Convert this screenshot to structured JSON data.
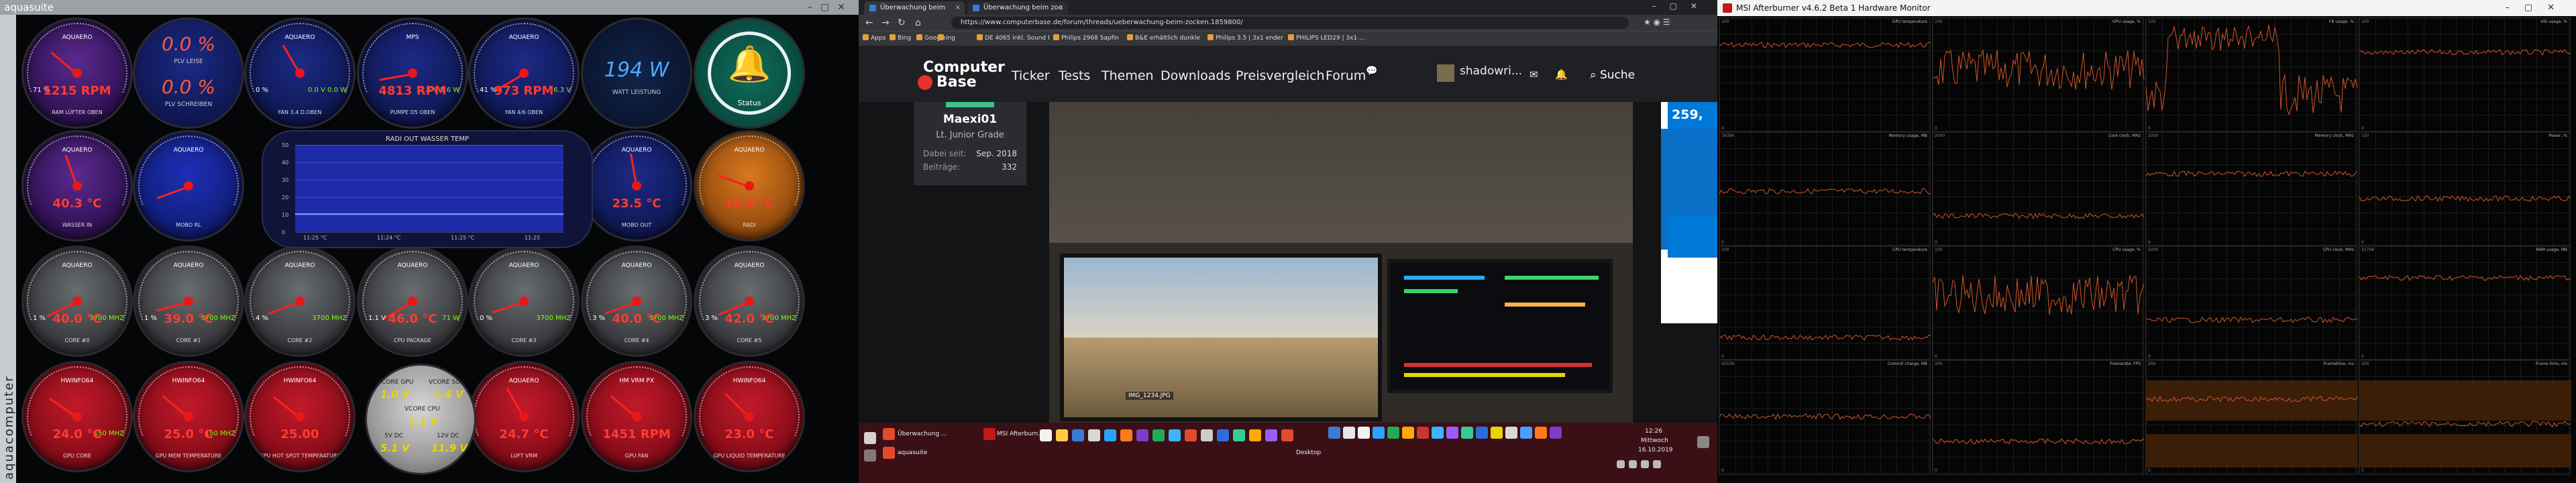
{
  "aquasuite": {
    "title": "aquasuite",
    "brand": "aquacomputer",
    "gauges": [
      {
        "label": "AQUAERO",
        "value": "1215 RPM",
        "unit": "",
        "name": "RAM LÜFTER OBEN",
        "left": "71 %",
        "right": ""
      },
      {
        "label": "",
        "value": "0.0 %",
        "unit": "",
        "name": "PLV LEISE",
        "left": "",
        "right": ""
      },
      {
        "label": "AQUAERO",
        "value": "",
        "unit": "",
        "name": "FAN 3.4 D.OBEN",
        "left": "0 %",
        "right": "0.0 V 0.0 W"
      },
      {
        "label": "MPS",
        "value": "4813 RPM",
        "unit": "",
        "name": "PUMPE D5 OBEN",
        "left": "",
        "right": "12.1 V 5.6 W"
      },
      {
        "label": "AQUAERO",
        "value": "973 RPM",
        "unit": "",
        "name": "FAN 4/6 OBEN",
        "left": "41 %",
        "right": "6.3 V"
      },
      {
        "label": "AQUAERO",
        "value": "40.3 °C",
        "unit": "°C",
        "name": "WASSER IN",
        "left": "",
        "right": ""
      },
      {
        "label": "AQUAERO",
        "value": "",
        "unit": "°C",
        "name": "MOBO RL",
        "left": "",
        "right": ""
      },
      {
        "label": "AQUAERO",
        "value": "23.5 °C",
        "unit": "°C",
        "name": "MOBO OUT",
        "left": "",
        "right": ""
      },
      {
        "label": "AQUAERO",
        "value": "19.8 °C",
        "unit": "°C",
        "name": "RADI",
        "left": "",
        "right": ""
      },
      {
        "label": "AQUAERO",
        "value": "40.0 °C",
        "unit": "°C",
        "name": "CORE #0",
        "left": "1 %",
        "right": "3700 MHZ"
      },
      {
        "label": "AQUAERO",
        "value": "39.0 °C",
        "unit": "°C",
        "name": "CORE #1",
        "left": "1 %",
        "right": "3700 MHZ"
      },
      {
        "label": "AQUAERO",
        "value": "",
        "unit": "°C",
        "name": "CORE #2",
        "left": "4 %",
        "right": "3700 MHZ"
      },
      {
        "label": "AQUAERO",
        "value": "46.0 °C",
        "unit": "°C",
        "name": "CPU PACKAGE",
        "left": "1.1 V",
        "right": "71 W"
      },
      {
        "label": "AQUAERO",
        "value": "",
        "unit": "°C",
        "name": "CORE #3",
        "left": "0 %",
        "right": "3700 MHZ"
      },
      {
        "label": "AQUAERO",
        "value": "40.0 °C",
        "unit": "°C",
        "name": "CORE #4",
        "left": "3 %",
        "right": "3700 MHZ"
      },
      {
        "label": "AQUAERO",
        "value": "42.0 °C",
        "unit": "°C",
        "name": "CORE #5",
        "left": "3 %",
        "right": "3700 MHZ"
      },
      {
        "label": "HWINFO64",
        "value": "24.0 °C",
        "unit": "°C",
        "name": "GPU CORE",
        "left": "",
        "right": "150 MHZ"
      },
      {
        "label": "HWINFO64",
        "value": "25.0 °C",
        "unit": "°C",
        "name": "GPU MEM TEMPERATURE",
        "left": "",
        "right": "150 MHZ"
      },
      {
        "label": "HWINFO64",
        "value": "25.00",
        "unit": "",
        "name": "GPU HOT SPOT TEMPERATURE",
        "left": "",
        "right": ""
      },
      {
        "label": "AQUAERO",
        "value": "24.7 °C",
        "unit": "°C",
        "name": "LUFT VRM",
        "left": "",
        "right": ""
      },
      {
        "label": "HM VRM PX",
        "value": "1451 RPM",
        "unit": "",
        "name": "GPU FAN",
        "left": "",
        "right": ""
      },
      {
        "label": "HWINFO64",
        "value": "23.0 °C",
        "unit": "°C",
        "name": "GPU LIQUID TEMPERATURE",
        "left": "",
        "right": ""
      }
    ],
    "digital": {
      "value": "194 W",
      "name": "WATT LEISTUNG"
    },
    "extra": {
      "top": "0.0 %",
      "top_label": "PLV LEISE",
      "bottom": "0.0 %",
      "bottom_label": "PLV SCHREIBEN"
    },
    "status": {
      "label": "Status"
    },
    "chart": {
      "title": "RADI OUT WASSER TEMP",
      "y_ticks": [
        "50",
        "40",
        "30",
        "20",
        "10",
        "0"
      ],
      "x_ticks": [
        "11:25 °C",
        "11:24 °C",
        "11:25 °C",
        "11:25"
      ]
    },
    "center": {
      "gpu_label": "VCORE GPU",
      "gpu_val": "1.0 V",
      "soc_label": "VCORE SOC",
      "soc_val": "1.4 V",
      "cpu_label": "VCORE CPU",
      "cpu_val": "1.1 V",
      "v5_label": "5V DC",
      "v5_val": "5.1 V",
      "v12_label": "12V DC",
      "v12_val": "11.9 V"
    }
  },
  "browser": {
    "tabs": [
      "Überwachung beim zocken",
      "Überwachung beim zoc"
    ],
    "url": "https://www.computerbase.de/forum/threads/ueberwachung-beim-zocken.1859800/",
    "bookmarks": [
      "Apps",
      "Bing",
      "Google",
      "ing",
      "DE 4065 inkl. Sound I",
      "Philips 2968 Sapfin",
      "B&E erhältlich dunkle",
      "Philips 3.5 | 3x1 ender",
      "PHILIPS LED29 | 3x1 ..."
    ],
    "logo_line1": "Computer",
    "logo_line2": "Base",
    "nav": [
      "Ticker",
      "Tests",
      "Themen",
      "Downloads",
      "Preisvergleich",
      "Forum"
    ],
    "username": "shadowri...",
    "search": "Suche",
    "post": {
      "name": "Maexi01",
      "rank": "Lt. Junior Grade",
      "joined_label": "Dabei seit:",
      "joined": "Sep. 2018",
      "posts_label": "Beiträge:",
      "posts": "332"
    },
    "photo_tag": "IMG_1234.JPG",
    "ad_price": "259,",
    "taskbar": {
      "items": [
        "Überwachung ...",
        "MSI Afterburn...",
        "aquasuite",
        "Desktop"
      ],
      "time": "12:26",
      "day": "Mittwoch",
      "date": "16.10.2019"
    }
  },
  "afterburner": {
    "title": "MSI Afterburner v4.6.2 Beta 1 Hardware Monitor",
    "graphs": [
      {
        "label": "GPU temperature",
        "top": "100",
        "bottom": "0"
      },
      {
        "label": "GPU usage, %",
        "top": "100",
        "bottom": "0"
      },
      {
        "label": "FB usage, %",
        "top": "100",
        "bottom": "0"
      },
      {
        "label": "VID usage, %",
        "top": "100",
        "bottom": "0"
      },
      {
        "label": "Memory usage, MB",
        "top": "16384",
        "bottom": "0"
      },
      {
        "label": "Core clock, MHz",
        "top": "2000",
        "bottom": "0"
      },
      {
        "label": "Memory clock, MHz",
        "top": "2000",
        "bottom": "0"
      },
      {
        "label": "Power, %",
        "top": "150",
        "bottom": "0"
      },
      {
        "label": "CPU temperature",
        "top": "100",
        "bottom": "0"
      },
      {
        "label": "CPU usage, %",
        "top": "100",
        "bottom": "0"
      },
      {
        "label": "CPU clock, MHz",
        "top": "5000",
        "bottom": "0"
      },
      {
        "label": "RAM usage, MB",
        "top": "32768",
        "bottom": "0"
      },
      {
        "label": "Commit charge, MB",
        "top": "65536",
        "bottom": "0"
      },
      {
        "label": "Framerate, FPS",
        "top": "200",
        "bottom": "0"
      },
      {
        "label": "Frametime, ms",
        "top": "200",
        "bottom": "0"
      },
      {
        "label": "Frame time, ms",
        "top": "200",
        "bottom": "0"
      }
    ]
  }
}
